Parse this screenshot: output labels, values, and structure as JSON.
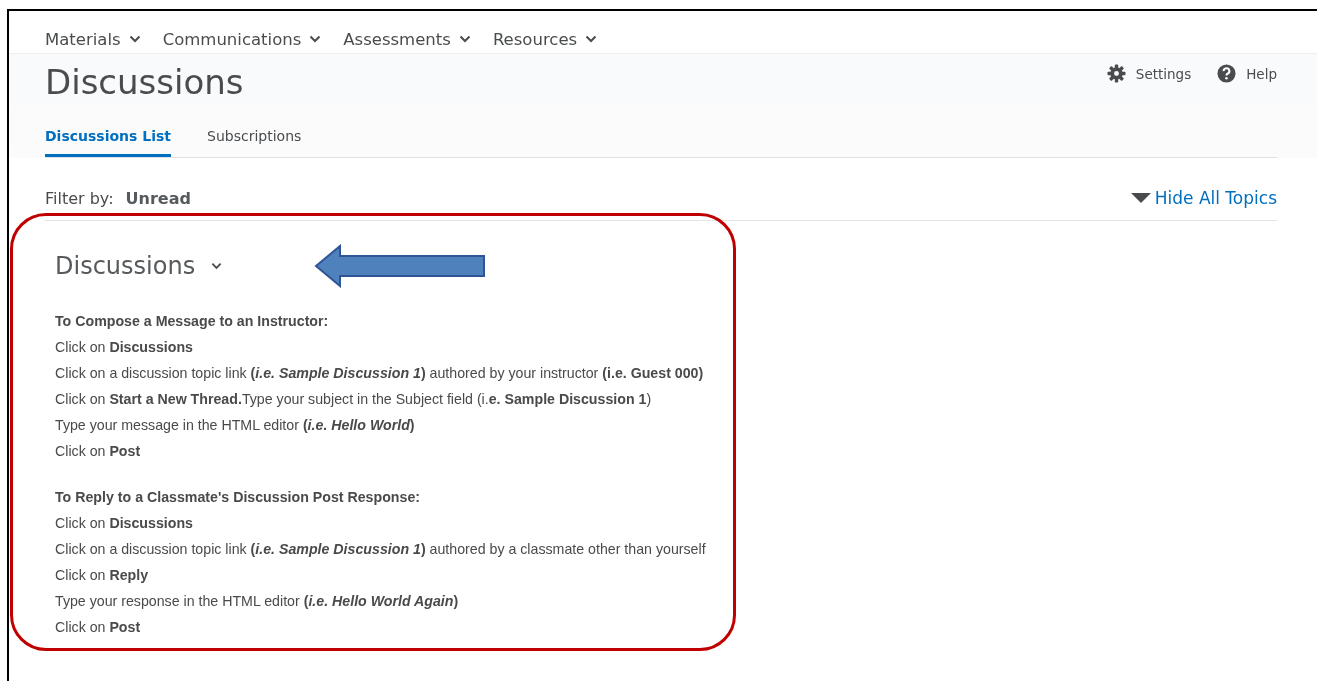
{
  "nav": [
    {
      "label": "Materials"
    },
    {
      "label": "Communications"
    },
    {
      "label": "Assessments"
    },
    {
      "label": "Resources"
    }
  ],
  "page_title": "Discussions",
  "header_actions": [
    {
      "kind": "settings",
      "label": "Settings"
    },
    {
      "kind": "help",
      "label": "Help"
    }
  ],
  "tabs": [
    {
      "label": "Discussions List",
      "selected": true
    },
    {
      "label": "Subscriptions",
      "selected": false
    }
  ],
  "filter": {
    "label": "Filter by:",
    "value": "Unread"
  },
  "hide_all_topics": "Hide All Topics",
  "section": {
    "title": "Discussions",
    "groups": [
      {
        "heading": "To Compose a Message to an Instructor:",
        "lines": [
          "Click on **Discussions**",
          "Click on a discussion topic link  **(*i.e. Sample Discussion 1*)** authored by your instructor **(i.e. Guest 000)**",
          "Click on **Start a New Thread.**Type your subject in the Subject field (i.**e. Sample Discussion 1**)",
          "Type your message in the HTML editor **(*i.e. Hello World*)**",
          "Click on **Post**"
        ]
      },
      {
        "heading": "To Reply to a Classmate's Discussion Post Response:",
        "lines": [
          "Click on **Discussions**",
          "Click on a discussion topic link  **(*i.e. Sample Discussion 1*)** authored by a classmate other than yourself",
          "Click on **Reply**",
          "Type your response in the HTML editor **(*i.e. Hello World Again*)**",
          "Click on **Post**"
        ]
      }
    ]
  }
}
